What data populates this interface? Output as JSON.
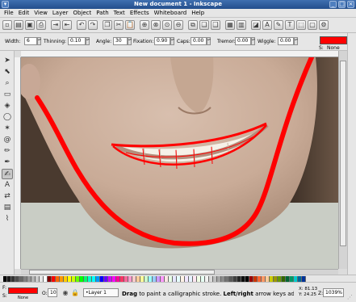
{
  "window": {
    "title": "New document 1 - Inkscape"
  },
  "menu": [
    "File",
    "Edit",
    "View",
    "Layer",
    "Object",
    "Path",
    "Text",
    "Effects",
    "Whiteboard",
    "Help"
  ],
  "controls": {
    "width_label": "Width:",
    "width_value": "6",
    "thinning_label": "Thinning:",
    "thinning_value": "0.10",
    "angle_label": "Angle:",
    "angle_value": "30",
    "fixation_label": "Fixation:",
    "fixation_value": "0.90",
    "caps_label": "Caps:",
    "caps_value": "0.00",
    "tremor_label": "Tremor:",
    "tremor_value": "0.00",
    "wiggle_label": "Wiggle:",
    "wiggle_value": "0.00",
    "style_s_label": "S:",
    "style_s_value": "None"
  },
  "status": {
    "fill_label": "F:",
    "stroke_label": "S:",
    "stroke_value": "None",
    "opacity_label": "O:",
    "opacity_value": "10",
    "layer": "•Layer 1",
    "message_bold": "Drag",
    "message_mid": " to paint a calligraphic stroke. ",
    "message_bold2": "Left/right",
    "message_tail": " arrow keys adju...",
    "x_label": "X:",
    "x_value": "81.13",
    "y_label": "Y:",
    "y_value": "24.25",
    "zoom_label": "Z:",
    "zoom_value": "1039%"
  },
  "colors": {
    "accent": "#ff0000",
    "title_bar": "#2f5e9e"
  },
  "palette": [
    "#000000",
    "#1a1a1a",
    "#333333",
    "#4d4d4d",
    "#666666",
    "#808080",
    "#999999",
    "#b3b3b3",
    "#cccccc",
    "#e6e6e6",
    "#ffffff",
    "#800000",
    "#ff0000",
    "#ff6600",
    "#ff9900",
    "#ffcc00",
    "#ffff00",
    "#ccff00",
    "#66ff00",
    "#00ff00",
    "#00ff66",
    "#00ffcc",
    "#00ffff",
    "#0099ff",
    "#0000ff",
    "#6600ff",
    "#cc00ff",
    "#ff00ff",
    "#ff0099",
    "#ff3366",
    "#ff6699",
    "#ff99cc",
    "#ffcccc",
    "#ffcc99",
    "#ffff99",
    "#ccffcc",
    "#99ffff",
    "#99ccff",
    "#cc99ff",
    "#ff99ff",
    "#ffe6e6",
    "#e6ffe6",
    "#e6e6ff",
    "#e6ffff",
    "#fff2e6",
    "#f2e6ff",
    "#e6f2ff",
    "#ffe6f2",
    "#f2ffe6",
    "#e6fff2",
    "#f2f2f2",
    "#d9d9d9",
    "#bfbfbf",
    "#a6a6a6",
    "#8c8c8c",
    "#737373",
    "#595959",
    "#404040",
    "#262626",
    "#0d0d0d",
    "#000000",
    "#990000",
    "#cc3300",
    "#ff6633",
    "#ff9966",
    "#ffcc99",
    "#cccc00",
    "#999900",
    "#669900",
    "#336600",
    "#006633",
    "#009966",
    "#00cccc",
    "#006699",
    "#003399"
  ]
}
